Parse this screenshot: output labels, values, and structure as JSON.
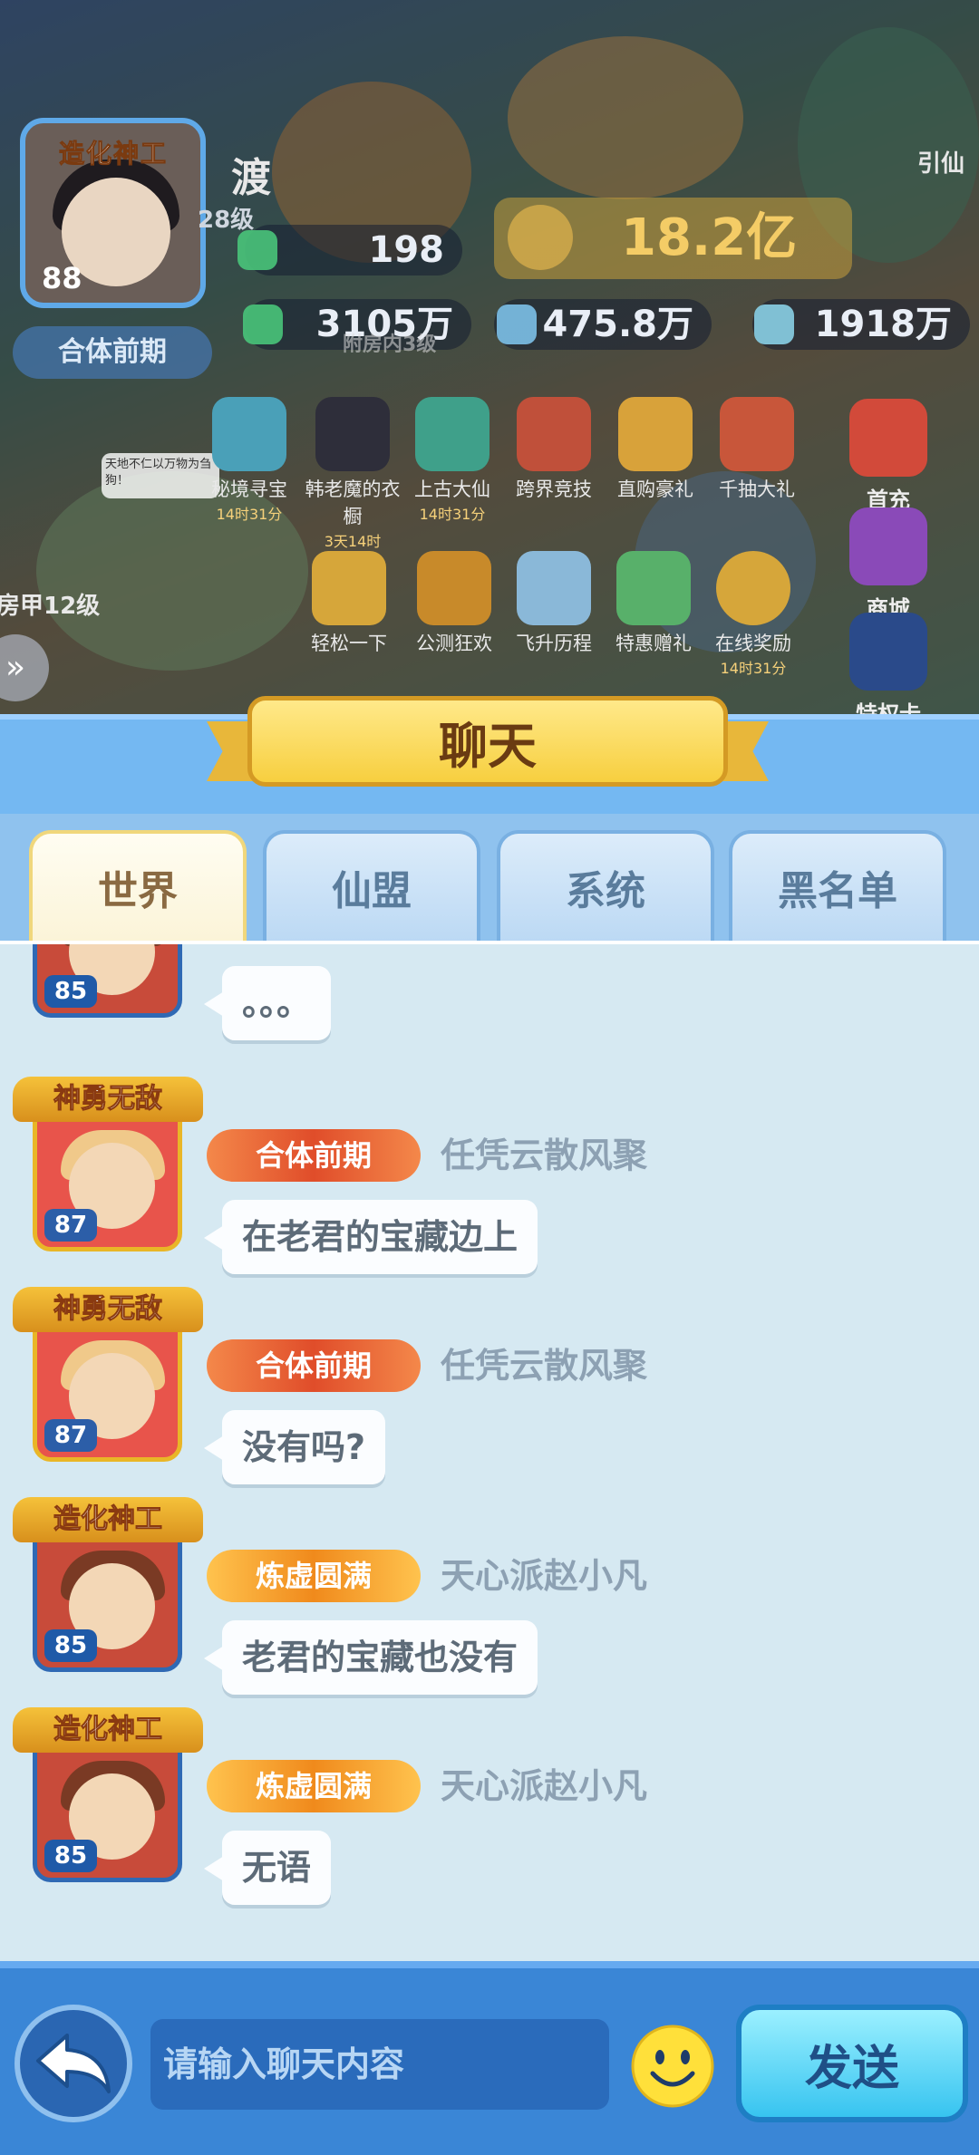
{
  "hud": {
    "player_name": "渡",
    "avatar_title": "造化神工",
    "avatar_level": "88",
    "sub_level": "28级",
    "realm": "合体前期",
    "gem_count": "198",
    "power": "18.2亿",
    "res_1": "3105万",
    "res_2": "475.8万",
    "res_3": "1918万",
    "faded_label": "附房内3级",
    "side_label": "引仙",
    "armor_label": "房甲12级",
    "speech": "天地不仁以万物为刍狗！"
  },
  "activities_row1": [
    {
      "label": "秘境寻宝",
      "timer": "14时31分"
    },
    {
      "label": "韩老魔的衣橱",
      "timer": "3天14时"
    },
    {
      "label": "上古大仙",
      "timer": "14时31分"
    },
    {
      "label": "跨界竞技",
      "timer": ""
    },
    {
      "label": "直购豪礼",
      "timer": ""
    },
    {
      "label": "千抽大礼",
      "timer": ""
    }
  ],
  "activities_row2": [
    {
      "label": "轻松一下",
      "timer": ""
    },
    {
      "label": "公测狂欢",
      "timer": ""
    },
    {
      "label": "飞升历程",
      "timer": ""
    },
    {
      "label": "特惠赠礼",
      "timer": ""
    },
    {
      "label": "在线奖励",
      "timer": "14时31分"
    }
  ],
  "side_buttons": [
    "首充",
    "商城",
    "特权卡"
  ],
  "chat": {
    "title": "聊天",
    "tabs": [
      "世界",
      "仙盟",
      "系统",
      "黑名单"
    ],
    "active_tab": "世界",
    "messages": [
      {
        "title": "",
        "level": "85",
        "rank": "",
        "sender": "",
        "text": "。。。"
      },
      {
        "title": "神勇无敌",
        "level": "87",
        "rank": "合体前期",
        "sender": "任凭云散风聚",
        "text": "在老君的宝藏边上"
      },
      {
        "title": "神勇无敌",
        "level": "87",
        "rank": "合体前期",
        "sender": "任凭云散风聚",
        "text": "没有吗?"
      },
      {
        "title": "造化神工",
        "level": "85",
        "rank": "炼虚圆满",
        "sender": "天心派赵小凡",
        "text": "老君的宝藏也没有"
      },
      {
        "title": "造化神工",
        "level": "85",
        "rank": "炼虚圆满",
        "sender": "天心派赵小凡",
        "text": "无语"
      }
    ]
  },
  "input": {
    "placeholder": "请输入聊天内容",
    "send_label": "发送"
  },
  "colors": {
    "panel_blue": "#74b8f2",
    "message_bg": "#d6e9f2",
    "rank_red": "#e04d2a",
    "rank_orange": "#f08a1c",
    "send_button": "#37c4f0"
  }
}
